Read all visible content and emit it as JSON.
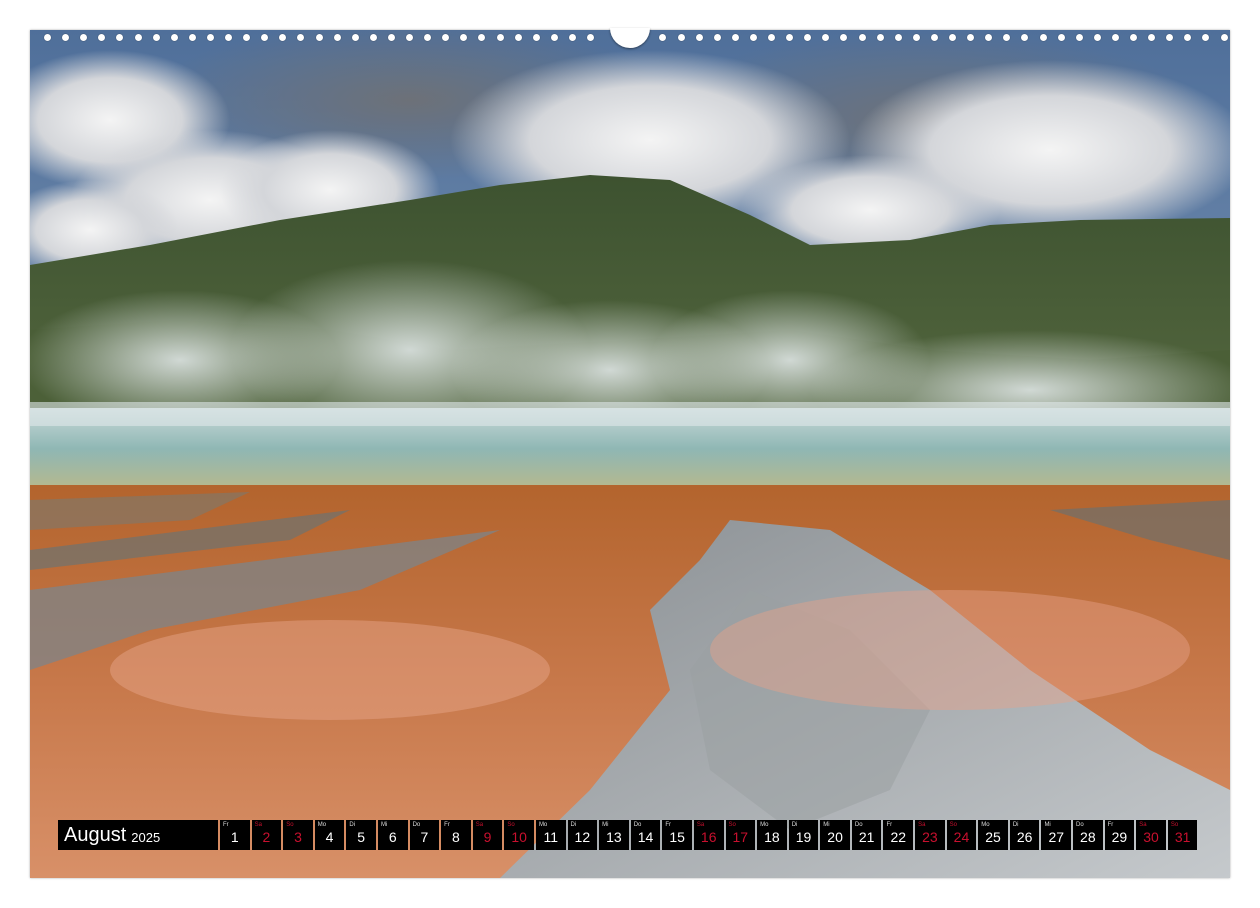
{
  "calendar": {
    "month": "August",
    "year": "2025",
    "accent_color": "#c8102e",
    "days": [
      {
        "wd": "Fr",
        "num": "1",
        "weekend": false
      },
      {
        "wd": "Sa",
        "num": "2",
        "weekend": true
      },
      {
        "wd": "So",
        "num": "3",
        "weekend": true
      },
      {
        "wd": "Mo",
        "num": "4",
        "weekend": false
      },
      {
        "wd": "Di",
        "num": "5",
        "weekend": false
      },
      {
        "wd": "Mi",
        "num": "6",
        "weekend": false
      },
      {
        "wd": "Do",
        "num": "7",
        "weekend": false
      },
      {
        "wd": "Fr",
        "num": "8",
        "weekend": false
      },
      {
        "wd": "Sa",
        "num": "9",
        "weekend": true
      },
      {
        "wd": "So",
        "num": "10",
        "weekend": true
      },
      {
        "wd": "Mo",
        "num": "11",
        "weekend": false
      },
      {
        "wd": "Di",
        "num": "12",
        "weekend": false
      },
      {
        "wd": "Mi",
        "num": "13",
        "weekend": false
      },
      {
        "wd": "Do",
        "num": "14",
        "weekend": false
      },
      {
        "wd": "Fr",
        "num": "15",
        "weekend": false
      },
      {
        "wd": "Sa",
        "num": "16",
        "weekend": true
      },
      {
        "wd": "So",
        "num": "17",
        "weekend": true
      },
      {
        "wd": "Mo",
        "num": "18",
        "weekend": false
      },
      {
        "wd": "Di",
        "num": "19",
        "weekend": false
      },
      {
        "wd": "Mi",
        "num": "20",
        "weekend": false
      },
      {
        "wd": "Do",
        "num": "21",
        "weekend": false
      },
      {
        "wd": "Fr",
        "num": "22",
        "weekend": false
      },
      {
        "wd": "Sa",
        "num": "23",
        "weekend": true
      },
      {
        "wd": "So",
        "num": "24",
        "weekend": true
      },
      {
        "wd": "Mo",
        "num": "25",
        "weekend": false
      },
      {
        "wd": "Di",
        "num": "26",
        "weekend": false
      },
      {
        "wd": "Mi",
        "num": "27",
        "weekend": false
      },
      {
        "wd": "Do",
        "num": "28",
        "weekend": false
      },
      {
        "wd": "Fr",
        "num": "29",
        "weekend": false
      },
      {
        "wd": "Sa",
        "num": "30",
        "weekend": true
      },
      {
        "wd": "So",
        "num": "31",
        "weekend": true
      }
    ]
  }
}
